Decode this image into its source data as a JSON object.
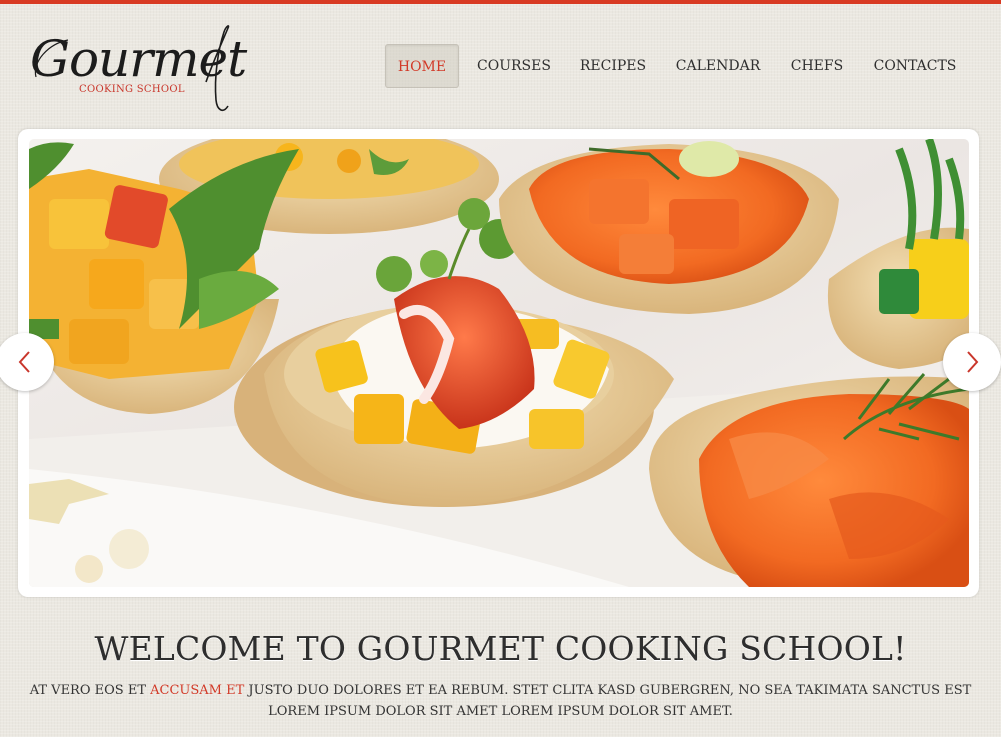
{
  "logo": {
    "script": "Gourmet",
    "subtitle": "COOKING SCHOOL"
  },
  "nav": {
    "items": [
      {
        "label": "HOME",
        "active": true
      },
      {
        "label": "COURSES"
      },
      {
        "label": "RECIPES"
      },
      {
        "label": "CALENDAR"
      },
      {
        "label": "CHEFS"
      },
      {
        "label": "CONTACTS"
      }
    ]
  },
  "slider": {
    "prev_icon": "chevron-left-icon",
    "next_icon": "chevron-right-icon",
    "image": "canapes-tartlets-photo"
  },
  "welcome": {
    "title": "WELCOME TO GOURMET COOKING SCHOOL!",
    "text_before": "AT VERO EOS ET ",
    "text_highlight": "ACCUSAM ET",
    "text_after": " JUSTO DUO DOLORES ET EA REBUM. STET CLITA KASD GUBERGREN, NO SEA TAKIMATA SANCTUS EST LOREM IPSUM DOLOR SIT AMET LOREM IPSUM DOLOR SIT AMET."
  },
  "colors": {
    "accent": "#d83a22",
    "background": "#ebe8e1",
    "text": "#2e2e2e"
  }
}
